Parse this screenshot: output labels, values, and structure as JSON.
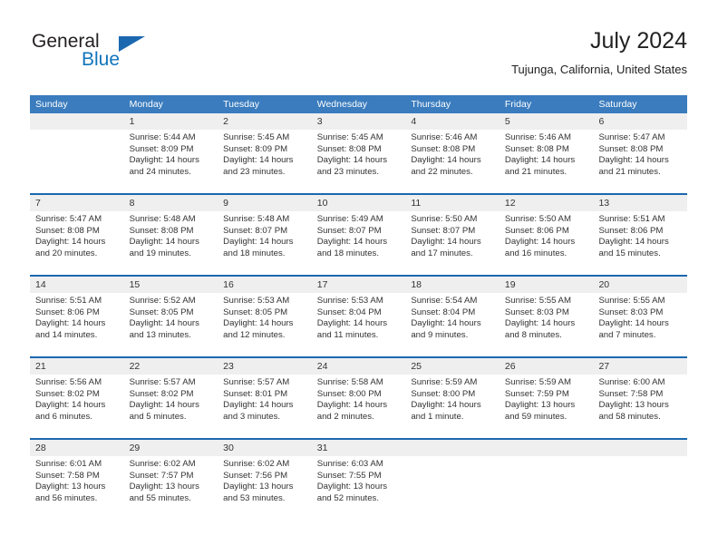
{
  "brand": {
    "name_part1": "General",
    "name_part2": "Blue",
    "triangle_color": "#1b68b0",
    "blue_color": "#1175bc"
  },
  "header": {
    "title": "July 2024",
    "subtitle": "Tujunga, California, United States"
  },
  "theme": {
    "header_band": "#3a7cbe",
    "row_rule": "#1b68b0",
    "date_band": "#efefef",
    "text": "#333333"
  },
  "calendar": {
    "weekdays": [
      "Sunday",
      "Monday",
      "Tuesday",
      "Wednesday",
      "Thursday",
      "Friday",
      "Saturday"
    ],
    "weeks": [
      [
        {
          "day": "",
          "sunrise": "",
          "sunset": "",
          "daylight1": "",
          "daylight2": ""
        },
        {
          "day": "1",
          "sunrise": "Sunrise: 5:44 AM",
          "sunset": "Sunset: 8:09 PM",
          "daylight1": "Daylight: 14 hours",
          "daylight2": "and 24 minutes."
        },
        {
          "day": "2",
          "sunrise": "Sunrise: 5:45 AM",
          "sunset": "Sunset: 8:09 PM",
          "daylight1": "Daylight: 14 hours",
          "daylight2": "and 23 minutes."
        },
        {
          "day": "3",
          "sunrise": "Sunrise: 5:45 AM",
          "sunset": "Sunset: 8:08 PM",
          "daylight1": "Daylight: 14 hours",
          "daylight2": "and 23 minutes."
        },
        {
          "day": "4",
          "sunrise": "Sunrise: 5:46 AM",
          "sunset": "Sunset: 8:08 PM",
          "daylight1": "Daylight: 14 hours",
          "daylight2": "and 22 minutes."
        },
        {
          "day": "5",
          "sunrise": "Sunrise: 5:46 AM",
          "sunset": "Sunset: 8:08 PM",
          "daylight1": "Daylight: 14 hours",
          "daylight2": "and 21 minutes."
        },
        {
          "day": "6",
          "sunrise": "Sunrise: 5:47 AM",
          "sunset": "Sunset: 8:08 PM",
          "daylight1": "Daylight: 14 hours",
          "daylight2": "and 21 minutes."
        }
      ],
      [
        {
          "day": "7",
          "sunrise": "Sunrise: 5:47 AM",
          "sunset": "Sunset: 8:08 PM",
          "daylight1": "Daylight: 14 hours",
          "daylight2": "and 20 minutes."
        },
        {
          "day": "8",
          "sunrise": "Sunrise: 5:48 AM",
          "sunset": "Sunset: 8:08 PM",
          "daylight1": "Daylight: 14 hours",
          "daylight2": "and 19 minutes."
        },
        {
          "day": "9",
          "sunrise": "Sunrise: 5:48 AM",
          "sunset": "Sunset: 8:07 PM",
          "daylight1": "Daylight: 14 hours",
          "daylight2": "and 18 minutes."
        },
        {
          "day": "10",
          "sunrise": "Sunrise: 5:49 AM",
          "sunset": "Sunset: 8:07 PM",
          "daylight1": "Daylight: 14 hours",
          "daylight2": "and 18 minutes."
        },
        {
          "day": "11",
          "sunrise": "Sunrise: 5:50 AM",
          "sunset": "Sunset: 8:07 PM",
          "daylight1": "Daylight: 14 hours",
          "daylight2": "and 17 minutes."
        },
        {
          "day": "12",
          "sunrise": "Sunrise: 5:50 AM",
          "sunset": "Sunset: 8:06 PM",
          "daylight1": "Daylight: 14 hours",
          "daylight2": "and 16 minutes."
        },
        {
          "day": "13",
          "sunrise": "Sunrise: 5:51 AM",
          "sunset": "Sunset: 8:06 PM",
          "daylight1": "Daylight: 14 hours",
          "daylight2": "and 15 minutes."
        }
      ],
      [
        {
          "day": "14",
          "sunrise": "Sunrise: 5:51 AM",
          "sunset": "Sunset: 8:06 PM",
          "daylight1": "Daylight: 14 hours",
          "daylight2": "and 14 minutes."
        },
        {
          "day": "15",
          "sunrise": "Sunrise: 5:52 AM",
          "sunset": "Sunset: 8:05 PM",
          "daylight1": "Daylight: 14 hours",
          "daylight2": "and 13 minutes."
        },
        {
          "day": "16",
          "sunrise": "Sunrise: 5:53 AM",
          "sunset": "Sunset: 8:05 PM",
          "daylight1": "Daylight: 14 hours",
          "daylight2": "and 12 minutes."
        },
        {
          "day": "17",
          "sunrise": "Sunrise: 5:53 AM",
          "sunset": "Sunset: 8:04 PM",
          "daylight1": "Daylight: 14 hours",
          "daylight2": "and 11 minutes."
        },
        {
          "day": "18",
          "sunrise": "Sunrise: 5:54 AM",
          "sunset": "Sunset: 8:04 PM",
          "daylight1": "Daylight: 14 hours",
          "daylight2": "and 9 minutes."
        },
        {
          "day": "19",
          "sunrise": "Sunrise: 5:55 AM",
          "sunset": "Sunset: 8:03 PM",
          "daylight1": "Daylight: 14 hours",
          "daylight2": "and 8 minutes."
        },
        {
          "day": "20",
          "sunrise": "Sunrise: 5:55 AM",
          "sunset": "Sunset: 8:03 PM",
          "daylight1": "Daylight: 14 hours",
          "daylight2": "and 7 minutes."
        }
      ],
      [
        {
          "day": "21",
          "sunrise": "Sunrise: 5:56 AM",
          "sunset": "Sunset: 8:02 PM",
          "daylight1": "Daylight: 14 hours",
          "daylight2": "and 6 minutes."
        },
        {
          "day": "22",
          "sunrise": "Sunrise: 5:57 AM",
          "sunset": "Sunset: 8:02 PM",
          "daylight1": "Daylight: 14 hours",
          "daylight2": "and 5 minutes."
        },
        {
          "day": "23",
          "sunrise": "Sunrise: 5:57 AM",
          "sunset": "Sunset: 8:01 PM",
          "daylight1": "Daylight: 14 hours",
          "daylight2": "and 3 minutes."
        },
        {
          "day": "24",
          "sunrise": "Sunrise: 5:58 AM",
          "sunset": "Sunset: 8:00 PM",
          "daylight1": "Daylight: 14 hours",
          "daylight2": "and 2 minutes."
        },
        {
          "day": "25",
          "sunrise": "Sunrise: 5:59 AM",
          "sunset": "Sunset: 8:00 PM",
          "daylight1": "Daylight: 14 hours",
          "daylight2": "and 1 minute."
        },
        {
          "day": "26",
          "sunrise": "Sunrise: 5:59 AM",
          "sunset": "Sunset: 7:59 PM",
          "daylight1": "Daylight: 13 hours",
          "daylight2": "and 59 minutes."
        },
        {
          "day": "27",
          "sunrise": "Sunrise: 6:00 AM",
          "sunset": "Sunset: 7:58 PM",
          "daylight1": "Daylight: 13 hours",
          "daylight2": "and 58 minutes."
        }
      ],
      [
        {
          "day": "28",
          "sunrise": "Sunrise: 6:01 AM",
          "sunset": "Sunset: 7:58 PM",
          "daylight1": "Daylight: 13 hours",
          "daylight2": "and 56 minutes."
        },
        {
          "day": "29",
          "sunrise": "Sunrise: 6:02 AM",
          "sunset": "Sunset: 7:57 PM",
          "daylight1": "Daylight: 13 hours",
          "daylight2": "and 55 minutes."
        },
        {
          "day": "30",
          "sunrise": "Sunrise: 6:02 AM",
          "sunset": "Sunset: 7:56 PM",
          "daylight1": "Daylight: 13 hours",
          "daylight2": "and 53 minutes."
        },
        {
          "day": "31",
          "sunrise": "Sunrise: 6:03 AM",
          "sunset": "Sunset: 7:55 PM",
          "daylight1": "Daylight: 13 hours",
          "daylight2": "and 52 minutes."
        },
        {
          "day": "",
          "sunrise": "",
          "sunset": "",
          "daylight1": "",
          "daylight2": ""
        },
        {
          "day": "",
          "sunrise": "",
          "sunset": "",
          "daylight1": "",
          "daylight2": ""
        },
        {
          "day": "",
          "sunrise": "",
          "sunset": "",
          "daylight1": "",
          "daylight2": ""
        }
      ]
    ]
  }
}
